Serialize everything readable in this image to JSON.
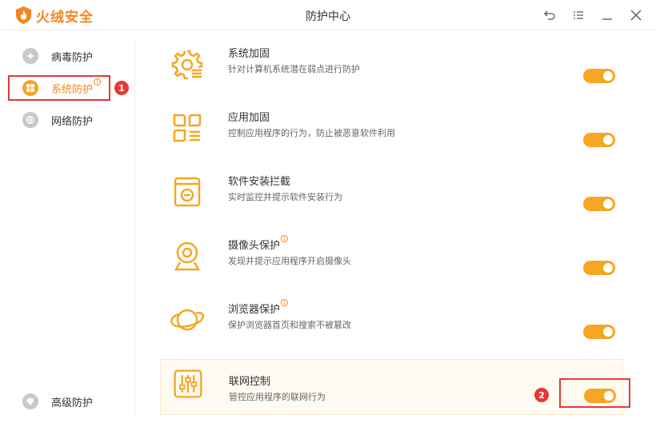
{
  "app": {
    "brand": "火绒安全",
    "window_title": "防护中心",
    "accent_color": "#f5a623",
    "brand_color": "#f5851f"
  },
  "window_controls": [
    "back-icon",
    "menu-icon",
    "minimize-icon",
    "close-icon"
  ],
  "sidebar": {
    "items": [
      {
        "label": "病毒防护",
        "icon": "virus-shield-icon",
        "active": false
      },
      {
        "label": "系统防护",
        "icon": "windows-icon",
        "active": true,
        "info": "i"
      },
      {
        "label": "网络防护",
        "icon": "globe-icon",
        "active": false
      }
    ],
    "bottom_item": {
      "label": "高级防护",
      "icon": "diamond-icon"
    }
  },
  "annotations": {
    "badge1": "1",
    "badge2": "2",
    "color": "#e53935"
  },
  "features": [
    {
      "title": "系统加固",
      "desc": "针对计算机系统潜在弱点进行防护",
      "icon": "gear-list-icon",
      "enabled": true
    },
    {
      "title": "应用加固",
      "desc": "控制应用程序的行为，防止被恶意软件利用",
      "icon": "apps-grid-icon",
      "enabled": true
    },
    {
      "title": "软件安装拦截",
      "desc": "实时监控并提示软件安装行为",
      "icon": "install-block-icon",
      "enabled": true
    },
    {
      "title": "摄像头保护",
      "desc": "发现并提示应用程序开启摄像头",
      "icon": "webcam-icon",
      "enabled": true,
      "info": "i"
    },
    {
      "title": "浏览器保护",
      "desc": "保护浏览器首页和搜索不被篡改",
      "icon": "planet-icon",
      "enabled": true,
      "info": "i"
    },
    {
      "title": "联网控制",
      "desc": "管控应用程序的联网行为",
      "icon": "sliders-icon",
      "enabled": true
    }
  ]
}
